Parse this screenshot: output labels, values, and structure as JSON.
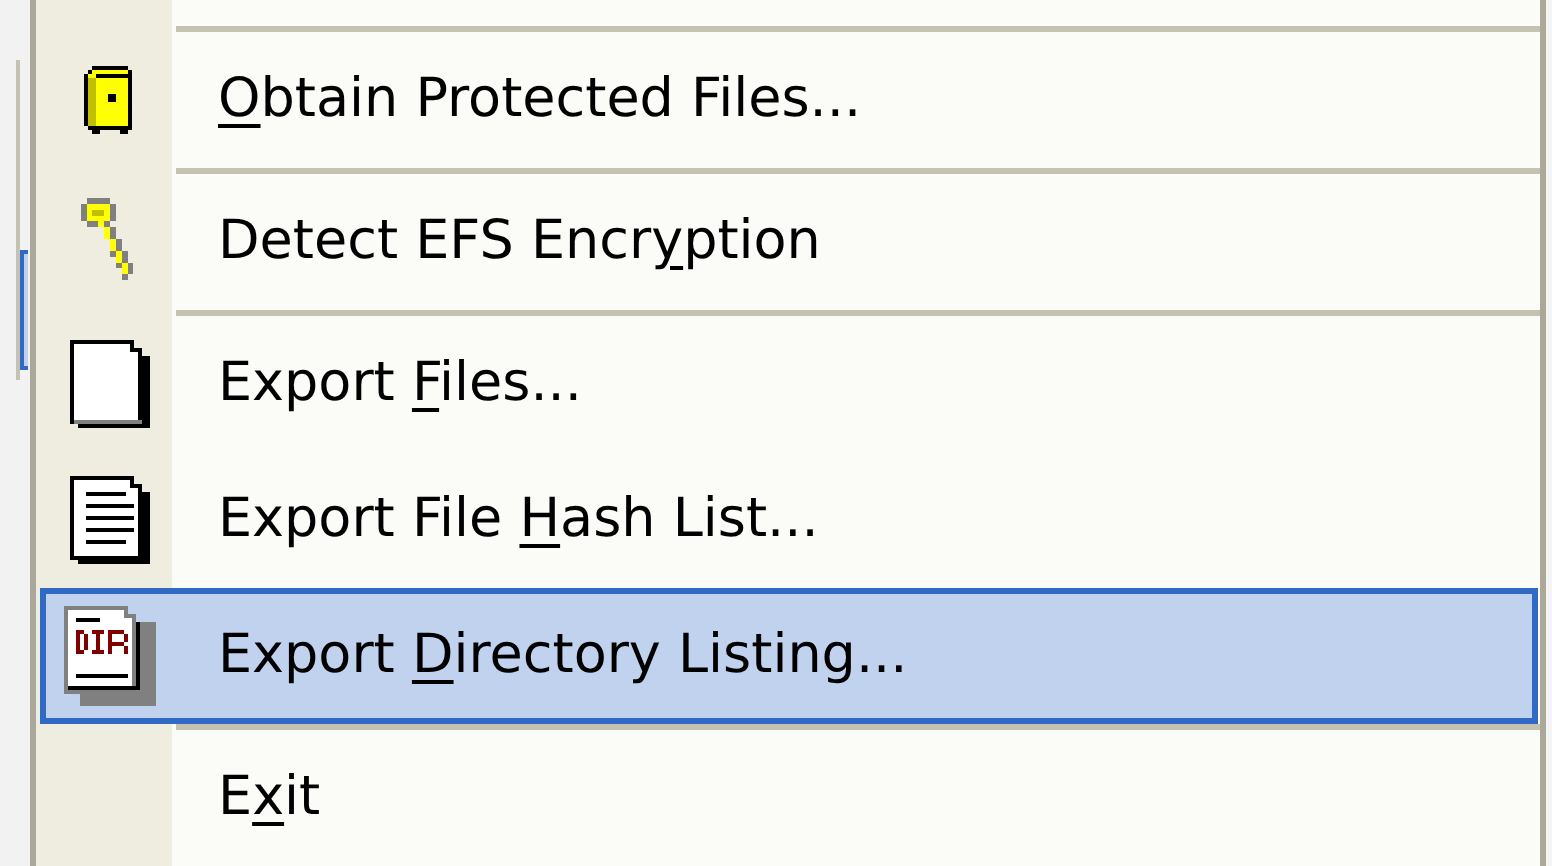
{
  "menu": {
    "items": [
      {
        "kind": "safe",
        "access_key": "O",
        "label_end": "btain Protected Files...",
        "selected": false,
        "separator_below": true
      },
      {
        "kind": "key",
        "label_start": "Detect EFS Encr",
        "access_key": "y",
        "label_end": "ption",
        "selected": false,
        "separator_below": true
      },
      {
        "kind": "page",
        "label_start": "Export ",
        "access_key": "F",
        "label_end": "iles...",
        "selected": false,
        "separator_below": false
      },
      {
        "kind": "text-page",
        "label_start": "Export File ",
        "access_key": "H",
        "label_end": "ash List...",
        "selected": false,
        "separator_below": false
      },
      {
        "kind": "dir-page",
        "label_start": "Export ",
        "access_key": "D",
        "label_end": "irectory Listing...",
        "selected": true,
        "separator_below": true
      },
      {
        "kind": "none",
        "label_start": "E",
        "access_key": "x",
        "label_end": "it",
        "selected": false,
        "separator_below": false
      }
    ]
  }
}
